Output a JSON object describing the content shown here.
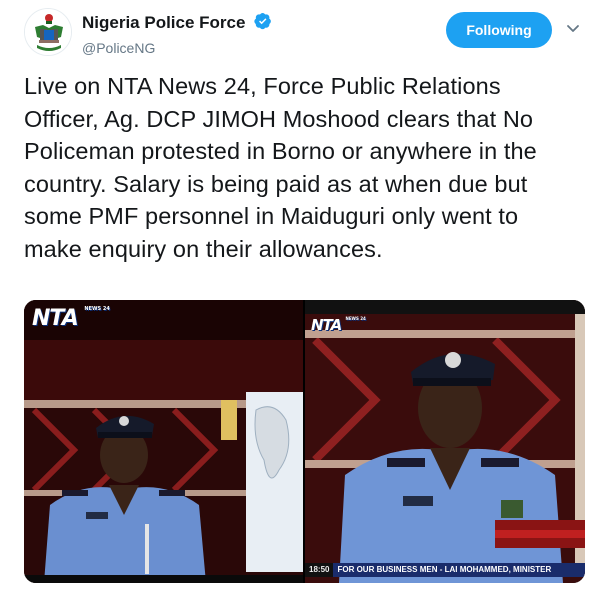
{
  "account": {
    "name": "Nigeria Police Force",
    "handle": "@PoliceNG",
    "verified": true,
    "avatar_icon": "police-crest-icon"
  },
  "actions": {
    "follow_label": "Following",
    "menu_icon": "chevron-down-icon"
  },
  "tweet": {
    "text": "Live on NTA News 24, Force Public Relations Officer, Ag. DCP JIMOH Moshood clears that No Policeman protested in Borno or anywhere in the country. Salary is being paid as at when due but some PMF personnel in Maiduguri only went to make enquiry on their allowances."
  },
  "media": {
    "left": {
      "logo": "NTA",
      "logo_sub": "NEWS 24"
    },
    "right": {
      "logo": "NTA",
      "logo_sub": "NEWS 24",
      "ticker_time": "18:50",
      "ticker_text": "FOR OUR BUSINESS MEN - LAI MOHAMMED, MINISTER"
    }
  },
  "colors": {
    "accent": "#1da1f2",
    "text": "#14171a",
    "secondary": "#657786"
  }
}
